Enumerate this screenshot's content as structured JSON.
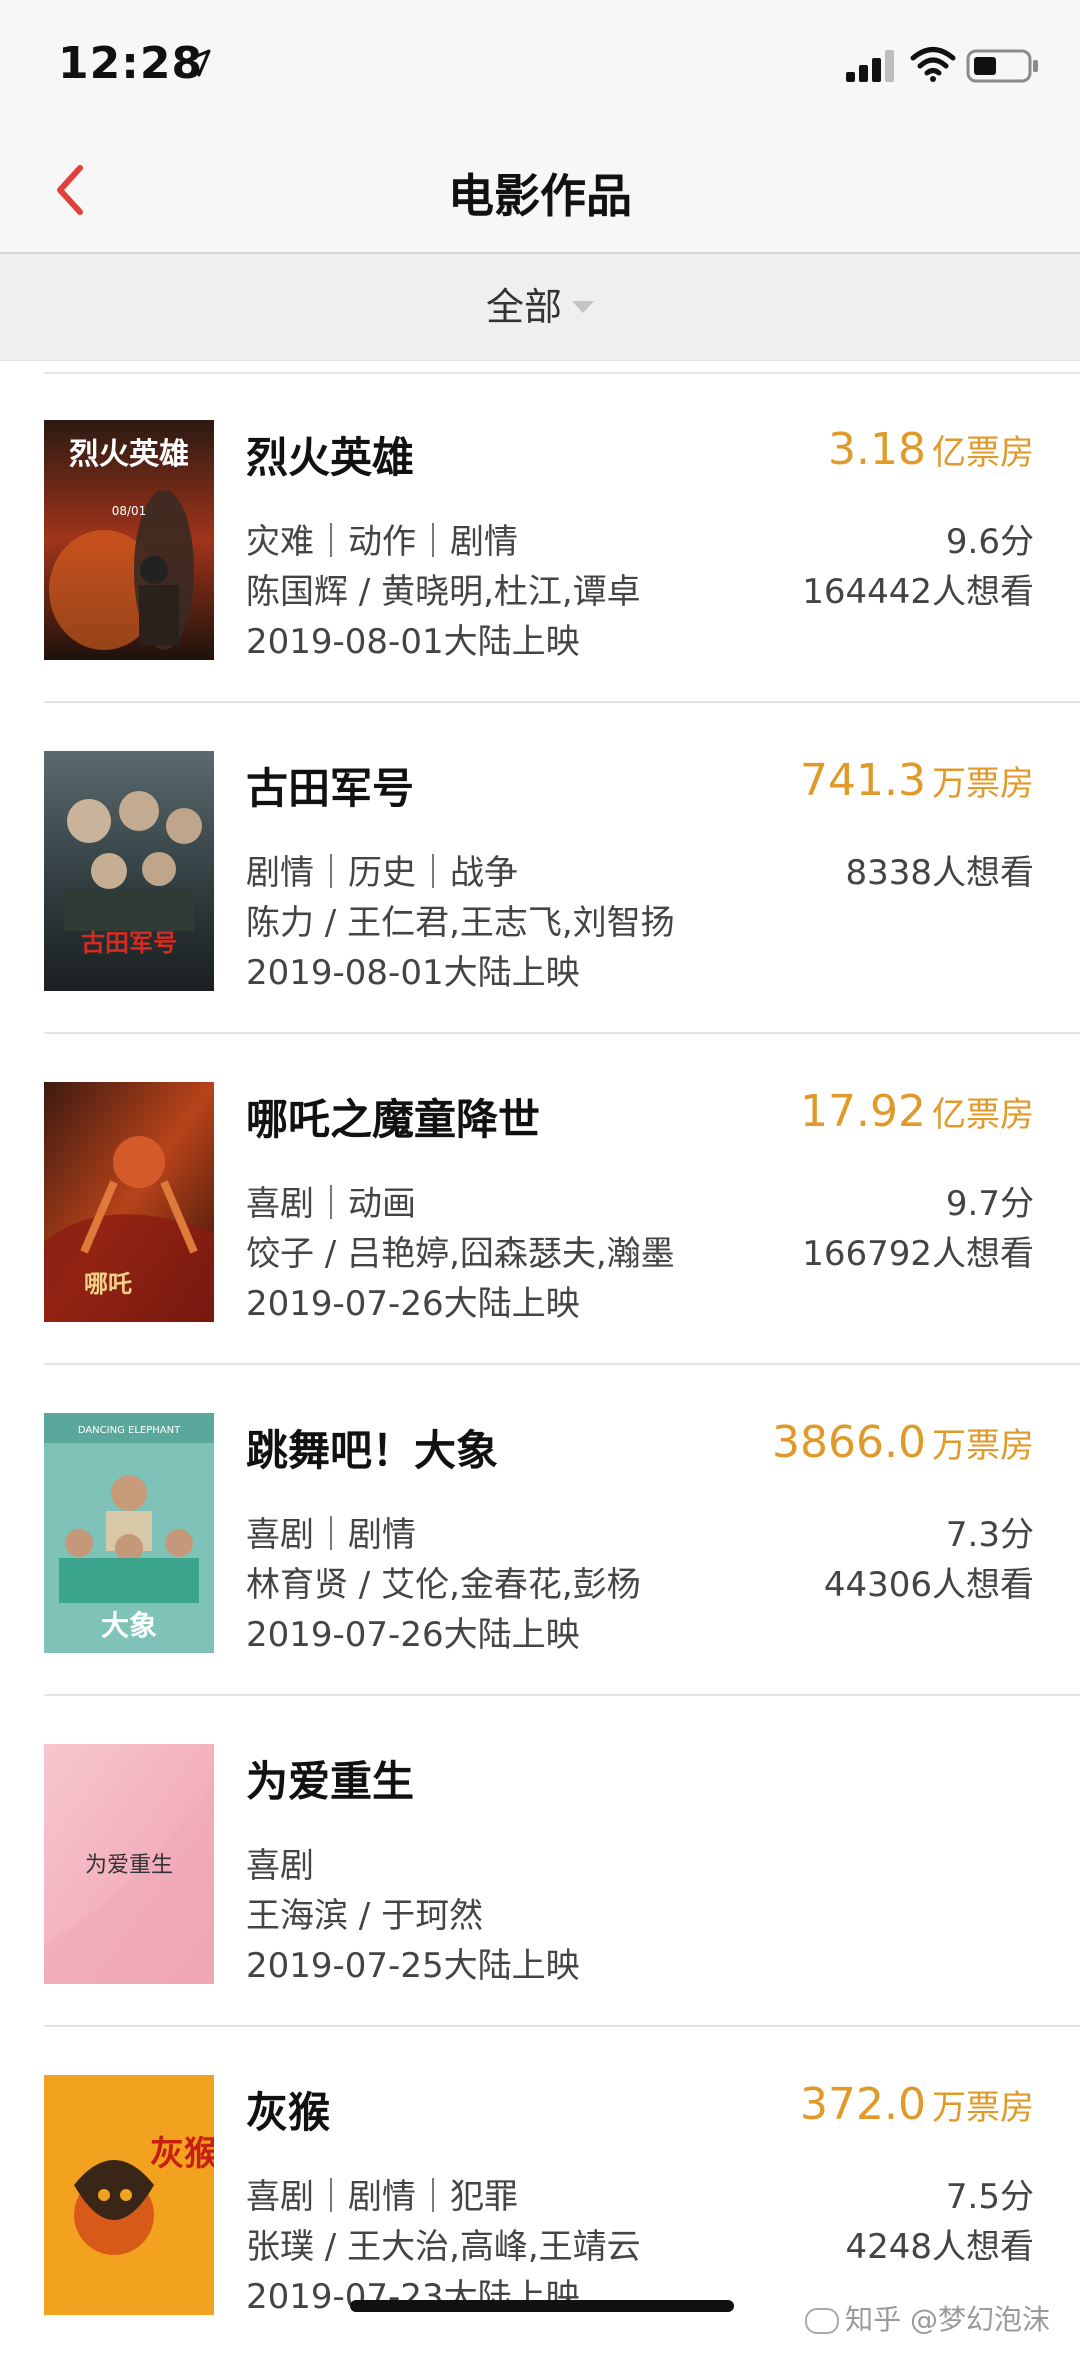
{
  "status_bar": {
    "time": "12:28",
    "icons": [
      "location-arrow-icon",
      "signal-icon",
      "wifi-icon",
      "battery-icon"
    ]
  },
  "nav": {
    "title": "电影作品",
    "back_icon": "chevron-left-icon"
  },
  "filter": {
    "label": "全部",
    "caret_icon": "caret-down-icon"
  },
  "colors": {
    "accent": "#e09a2a",
    "back_arrow": "#e0413a"
  },
  "movies": [
    {
      "title": "烈火英雄",
      "genres": "灾难｜动作｜剧情",
      "cast": "陈国辉 / 黄晓明,杜江,谭卓",
      "release": "2019-08-01大陆上映",
      "box_value": "3.18",
      "box_unit": "亿票房",
      "score": "9.6分",
      "wants": "164442人想看",
      "poster": {
        "text": "烈火英雄",
        "date": "08/01"
      }
    },
    {
      "title": "古田军号",
      "genres": "剧情｜历史｜战争",
      "cast": "陈力 / 王仁君,王志飞,刘智扬",
      "release": "2019-08-01大陆上映",
      "box_value": "741.3",
      "box_unit": "万票房",
      "score": "",
      "wants": "8338人想看",
      "poster": {
        "text": "古田军号"
      }
    },
    {
      "title": "哪吒之魔童降世",
      "genres": "喜剧｜动画",
      "cast": "饺子 / 吕艳婷,囧森瑟夫,瀚墨",
      "release": "2019-07-26大陆上映",
      "box_value": "17.92",
      "box_unit": "亿票房",
      "score": "9.7分",
      "wants": "166792人想看",
      "poster": {
        "text": "哪吒"
      }
    },
    {
      "title": "跳舞吧！大象",
      "genres": "喜剧｜剧情",
      "cast": "林育贤 / 艾伦,金春花,彭杨",
      "release": "2019-07-26大陆上映",
      "box_value": "3866.0",
      "box_unit": "万票房",
      "score": "7.3分",
      "wants": "44306人想看",
      "poster": {
        "text": "大象",
        "subtitle": "DANCING ELEPHANT"
      }
    },
    {
      "title": "为爱重生",
      "genres": "喜剧",
      "cast": "王海滨 / 于珂然",
      "release": "2019-07-25大陆上映",
      "box_value": "",
      "box_unit": "",
      "score": "",
      "wants": "",
      "poster": {
        "text": "为爱重生"
      }
    },
    {
      "title": "灰猴",
      "genres": "喜剧｜剧情｜犯罪",
      "cast": "张璞 / 王大治,高峰,王靖云",
      "release": "2019-07-23大陆上映",
      "box_value": "372.0",
      "box_unit": "万票房",
      "score": "7.5分",
      "wants": "4248人想看",
      "poster": {
        "text": "灰猴"
      }
    }
  ],
  "watermark": "知乎 @梦幻泡沫"
}
